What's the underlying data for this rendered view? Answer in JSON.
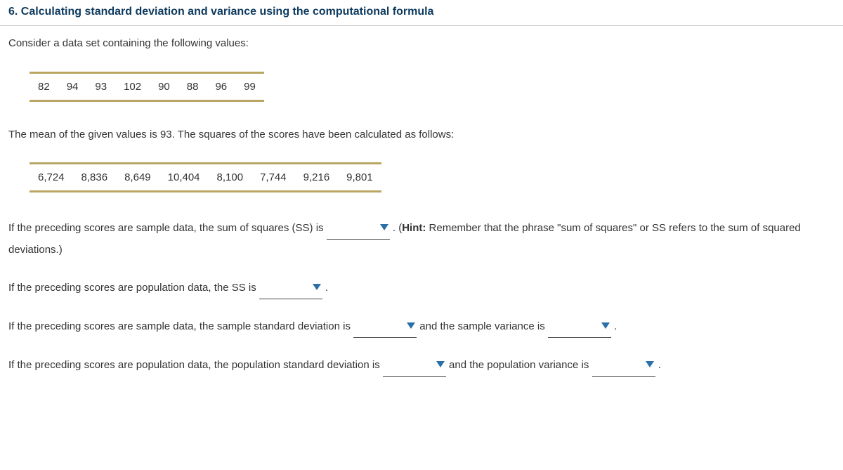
{
  "heading": "6. Calculating standard deviation and variance using the computational formula",
  "intro": "Consider a data set containing the following values:",
  "values_row": [
    "82",
    "94",
    "93",
    "102",
    "90",
    "88",
    "96",
    "99"
  ],
  "mean_text": "The mean of the given values is 93. The squares of the scores have been calculated as follows:",
  "squares_row": [
    "6,724",
    "8,836",
    "8,649",
    "10,404",
    "8,100",
    "7,744",
    "9,216",
    "9,801"
  ],
  "q1_a": "If the preceding scores are sample data, the sum of squares (SS) is ",
  "q1_b": " . (",
  "q1_hint_label": "Hint:",
  "q1_c": " Remember that the phrase \"sum of squares\" or SS refers to the sum of squared deviations.)",
  "q2_a": "If the preceding scores are population data, the SS is ",
  "q2_b": " .",
  "q3_a": "If the preceding scores are sample data, the sample standard deviation is ",
  "q3_b": " and the sample variance is ",
  "q3_c": " .",
  "q4_a": "If the preceding scores are population data, the population standard deviation is ",
  "q4_b": " and the population variance is ",
  "q4_c": " ."
}
